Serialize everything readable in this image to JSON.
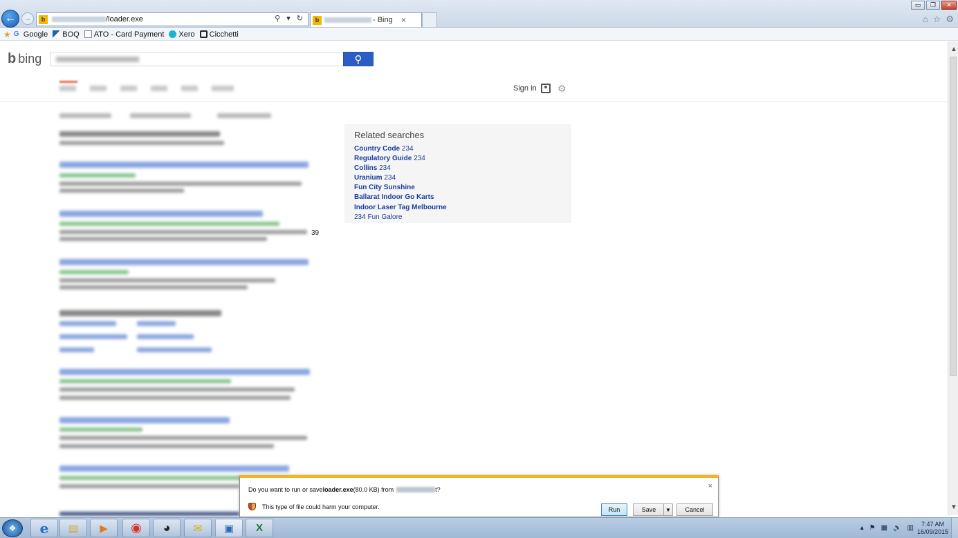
{
  "browser": {
    "address_text": "/loader.exe",
    "address_tools": "⚲ ▾ ↻",
    "tab_title": "- Bing",
    "tab_close": "×",
    "win_minimize": "▭",
    "win_restore": "❐",
    "win_close": "✕",
    "right_icons": [
      "⌂",
      "☆",
      "⚙"
    ]
  },
  "favorites": [
    {
      "label": "Google",
      "icon": "google-icon",
      "color": "#4285f4"
    },
    {
      "label": "BOQ",
      "icon": "boq-icon",
      "color": "#1f5fa8"
    },
    {
      "label": "ATO - Card Payment",
      "icon": "page-icon",
      "color": "#888888"
    },
    {
      "label": "Xero",
      "icon": "xero-icon",
      "color": "#1ab4d7"
    },
    {
      "label": "Cicchetti",
      "icon": "cicchetti-icon",
      "color": "#222222"
    }
  ],
  "bing": {
    "logo_text": "bing",
    "signin_label": "Sign in"
  },
  "stray_text": "39",
  "related": {
    "title": "Related searches",
    "items": [
      {
        "bold": "Country Code",
        "rest": " 234"
      },
      {
        "bold": "Regulatory Guide",
        "rest": " 234"
      },
      {
        "bold": "Collins",
        "rest": " 234"
      },
      {
        "bold": "Uranium",
        "rest": " 234"
      },
      {
        "bold": "Fun City Sunshine",
        "rest": ""
      },
      {
        "bold": "Ballarat Indoor Go Karts",
        "rest": ""
      },
      {
        "bold": "Indoor Laser Tag Melbourne",
        "rest": ""
      },
      {
        "bold": "",
        "rest": "234 Fun Galore"
      }
    ]
  },
  "download": {
    "question_prefix": "Do you want to run or save ",
    "filename": "loader.exe",
    "size": " (80.0 KB) from ",
    "question_suffix": "t?",
    "warning": "This type of file could harm your computer.",
    "run_label": "Run",
    "save_label": "Save",
    "cancel_label": "Cancel",
    "close": "×",
    "accent_color": "#f2b521"
  },
  "taskbar": {
    "items": [
      {
        "name": "ie-icon",
        "glyph": "e",
        "color": "#1e6fd0"
      },
      {
        "name": "explorer-icon",
        "glyph": "▤",
        "color": "#d9a93c"
      },
      {
        "name": "media-player-icon",
        "glyph": "▶",
        "color": "#e07a1f"
      },
      {
        "name": "chrome-icon",
        "glyph": "◉",
        "color": "#d93025"
      },
      {
        "name": "app-penguin-icon",
        "glyph": "◕",
        "color": "#222222"
      },
      {
        "name": "mail-icon",
        "glyph": "✉",
        "color": "#e6a800"
      },
      {
        "name": "remote-desktop-icon",
        "glyph": "▣",
        "color": "#2a6ab5"
      },
      {
        "name": "excel-icon",
        "glyph": "X",
        "color": "#1f7a3a"
      }
    ],
    "tray_icons": [
      "▴",
      "⚑",
      "▦",
      "🔊",
      "▥"
    ],
    "time": "7:47 AM",
    "date": "16/09/2015"
  }
}
